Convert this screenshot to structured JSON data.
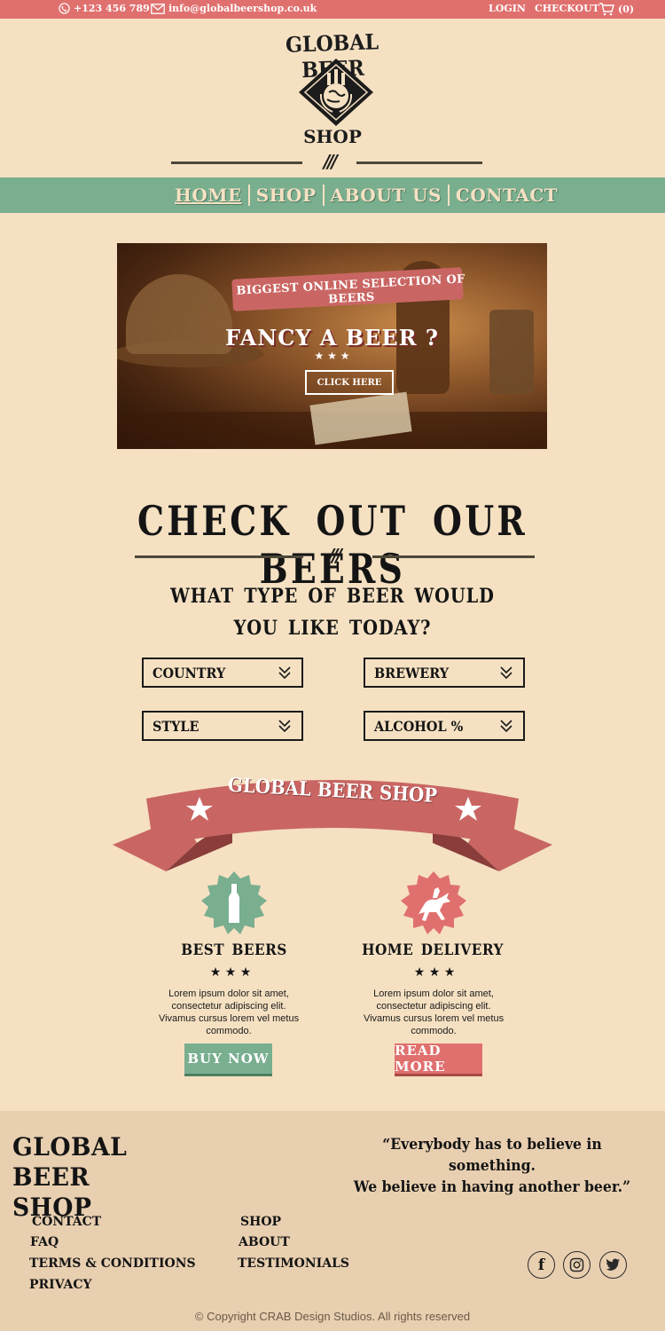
{
  "topbar": {
    "phone": "+123  456  789",
    "email": "info@globalbeershop.co.uk",
    "login": "LOGIN",
    "checkout": "CHECKOUT",
    "cart": "(0)"
  },
  "logo": {
    "line1": "GLOBAL BEER",
    "line2": "SHOP"
  },
  "nav": {
    "items": [
      {
        "label": "HOME"
      },
      {
        "label": "SHOP"
      },
      {
        "label": "ABOUT US"
      },
      {
        "label": "CONTACT"
      }
    ]
  },
  "hero": {
    "ribbon": "BIGGEST ONLINE SELECTION OF BEERS",
    "headline": "FANCY A BEER ?",
    "stars": "★ ★ ★",
    "cta": "CLICK HERE"
  },
  "beers": {
    "heading": "CHECK OUT OUR BEERS",
    "divider": "///",
    "question_line1": "WHAT TYPE OF BEER WOULD",
    "question_line2": "YOU LIKE TODAY?",
    "filters": [
      {
        "label": "COUNTRY"
      },
      {
        "label": "BREWERY"
      },
      {
        "label": "STYLE"
      },
      {
        "label": "ALCOHOL %"
      }
    ]
  },
  "banner": {
    "text": "GLOBAL BEER SHOP"
  },
  "features": [
    {
      "title": "BEST BEERS",
      "stars": "★ ★ ★",
      "body": "Lorem ipsum dolor sit amet, consectetur adipiscing elit. Vivamus cursus lorem vel metus commodo.",
      "button": "BUY  NOW",
      "color": "#79ae8f",
      "icon": "beer-bottle-icon"
    },
    {
      "title": "HOME  DELIVERY",
      "stars": "★ ★ ★",
      "body": "Lorem ipsum dolor sit amet, consectetur adipiscing elit. Vivamus cursus lorem vel metus commodo.",
      "button": "READ  MORE",
      "color": "#e0706e",
      "icon": "horse-rider-icon"
    }
  ],
  "footer": {
    "title_line1": "GLOBAL BEER",
    "title_line2": "SHOP",
    "quote_line1": "“Everybody has to believe in something.",
    "quote_line2": "We believe in having another beer.”",
    "links_col1": [
      {
        "label": "CONTACT"
      },
      {
        "label": "FAQ"
      },
      {
        "label": "TERMS & CONDITIONS"
      },
      {
        "label": "PRIVACY"
      }
    ],
    "links_col2": [
      {
        "label": "SHOP"
      },
      {
        "label": "ABOUT"
      },
      {
        "label": "TESTIMONIALS"
      }
    ],
    "social": [
      {
        "icon": "facebook-icon",
        "glyph": "f"
      },
      {
        "icon": "instagram-icon"
      },
      {
        "icon": "twitter-icon"
      }
    ],
    "copyright": "© Copyright CRAB Design Studios. All rights reserved"
  },
  "colors": {
    "accent_red": "#e0706e",
    "accent_green": "#79ae8f",
    "background": "#f5e1c2",
    "footer": "#e8cfb0"
  }
}
